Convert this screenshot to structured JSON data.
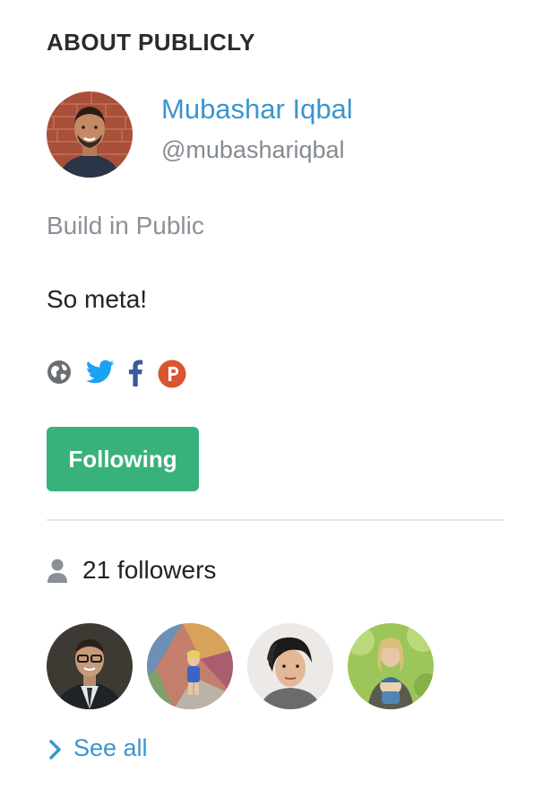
{
  "section": {
    "title": "ABOUT PUBLICLY"
  },
  "maker": {
    "name": "Mubashar Iqbal",
    "handle": "@mubashariqbal",
    "avatar_icon": "user-avatar-photo"
  },
  "product": {
    "tagline": "Build in Public",
    "description": "So meta!"
  },
  "social": {
    "links": [
      {
        "name": "website",
        "icon": "globe-icon",
        "color": "#6b6f73"
      },
      {
        "name": "twitter",
        "icon": "twitter-icon",
        "color": "#1da1f2"
      },
      {
        "name": "facebook",
        "icon": "facebook-icon",
        "color": "#3b5998"
      },
      {
        "name": "producthunt",
        "icon": "producthunt-icon",
        "color": "#da552f"
      }
    ]
  },
  "follow": {
    "label": "Following",
    "color": "#38b27a"
  },
  "followers": {
    "count_label": "21 followers",
    "icon": "person-icon",
    "avatars": [
      {
        "icon": "follower-avatar-photo"
      },
      {
        "icon": "follower-avatar-photo"
      },
      {
        "icon": "follower-avatar-photo"
      },
      {
        "icon": "follower-avatar-photo"
      }
    ],
    "see_all_label": "See all"
  },
  "colors": {
    "link": "#3a95cf",
    "muted": "#8a9197",
    "divider": "#e4e6e8"
  }
}
